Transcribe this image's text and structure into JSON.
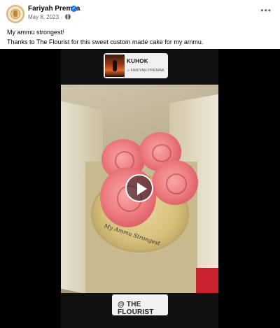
{
  "post": {
    "author": "Fariyah Premaa",
    "date": "May 8, 2023",
    "date_separator": "·",
    "more_label": "•••",
    "line1": "My ammu strongest!",
    "line2_prefix": "Thanks to ",
    "line2_link": "The Flourist",
    "line2_suffix": " for this sweet custom made cake for my ammu.",
    "verified_icon": "verified-badge-icon",
    "audience_icon": "globe-icon"
  },
  "video": {
    "music": {
      "title": "KUHOK",
      "artist": "♫ FARIYAH PREMAA"
    },
    "cake_inscription": "My Ammu Strongest",
    "tag": "@ THE FLOURIST",
    "play_icon": "play-icon"
  },
  "colors": {
    "link": "#385898",
    "verified": "#1877f2",
    "media_bg": "#000000"
  }
}
